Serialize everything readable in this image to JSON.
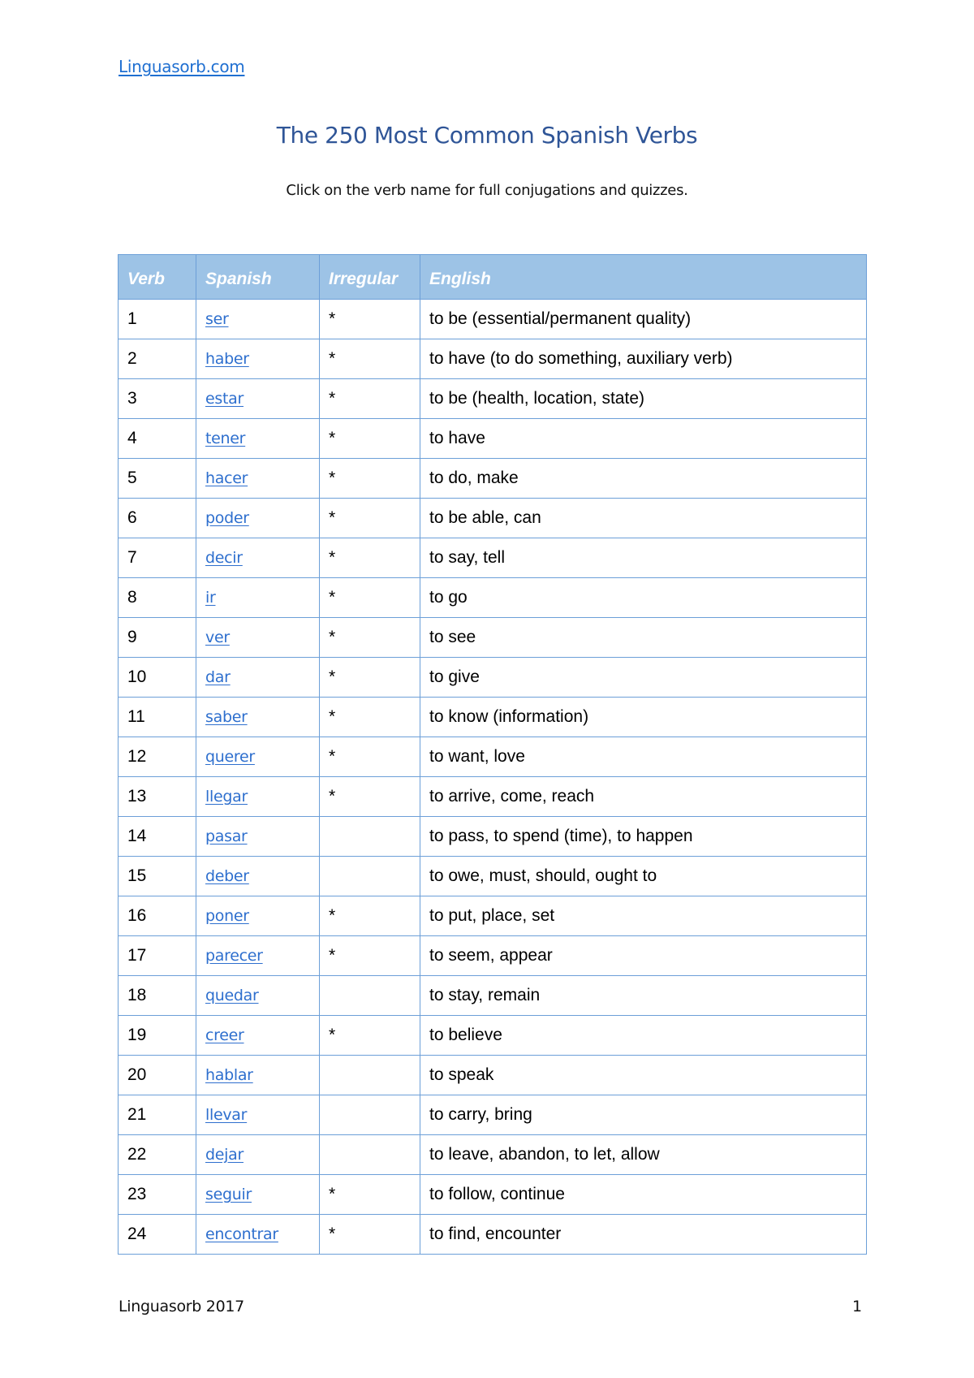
{
  "header": {
    "site_link": "Linguasorb.com"
  },
  "title": "The 250 Most Common Spanish Verbs",
  "subtitle": "Click on the verb name for full conjugations and quizzes.",
  "colors": {
    "link": "#2e6fce",
    "title": "#2f5597",
    "table_header_bg": "#9dc3e6",
    "table_border": "#6c9fd8"
  },
  "table": {
    "columns": [
      "Verb",
      "Spanish",
      "Irregular",
      "English"
    ],
    "rows": [
      {
        "num": "1",
        "spanish": "ser",
        "irregular": "*",
        "english": "to be (essential/permanent quality)"
      },
      {
        "num": "2",
        "spanish": "haber",
        "irregular": "*",
        "english": "to have (to do something, auxiliary verb)"
      },
      {
        "num": "3",
        "spanish": "estar",
        "irregular": "*",
        "english": "to be (health, location, state)"
      },
      {
        "num": "4",
        "spanish": "tener",
        "irregular": "*",
        "english": "to have"
      },
      {
        "num": "5",
        "spanish": "hacer",
        "irregular": "*",
        "english": "to do, make"
      },
      {
        "num": "6",
        "spanish": "poder",
        "irregular": "*",
        "english": "to be able, can"
      },
      {
        "num": "7",
        "spanish": "decir",
        "irregular": "*",
        "english": "to say, tell"
      },
      {
        "num": "8",
        "spanish": "ir",
        "irregular": "*",
        "english": "to go"
      },
      {
        "num": "9",
        "spanish": "ver",
        "irregular": "*",
        "english": "to see"
      },
      {
        "num": "10",
        "spanish": "dar",
        "irregular": "*",
        "english": "to give"
      },
      {
        "num": "11",
        "spanish": "saber",
        "irregular": "*",
        "english": "to know (information)"
      },
      {
        "num": "12",
        "spanish": "querer",
        "irregular": "*",
        "english": "to want, love"
      },
      {
        "num": "13",
        "spanish": "llegar",
        "irregular": "*",
        "english": "to arrive, come, reach"
      },
      {
        "num": "14",
        "spanish": "pasar",
        "irregular": "",
        "english": "to pass, to spend (time), to happen"
      },
      {
        "num": "15",
        "spanish": "deber",
        "irregular": "",
        "english": "to owe, must, should, ought to"
      },
      {
        "num": "16",
        "spanish": "poner",
        "irregular": "*",
        "english": "to put, place, set"
      },
      {
        "num": "17",
        "spanish": "parecer",
        "irregular": "*",
        "english": "to seem, appear"
      },
      {
        "num": "18",
        "spanish": "quedar",
        "irregular": "",
        "english": "to stay, remain"
      },
      {
        "num": "19",
        "spanish": "creer",
        "irregular": "*",
        "english": "to believe"
      },
      {
        "num": "20",
        "spanish": "hablar",
        "irregular": "",
        "english": "to speak"
      },
      {
        "num": "21",
        "spanish": "llevar",
        "irregular": "",
        "english": "to carry, bring"
      },
      {
        "num": "22",
        "spanish": "dejar",
        "irregular": "",
        "english": "to leave, abandon, to let, allow"
      },
      {
        "num": "23",
        "spanish": "seguir",
        "irregular": "*",
        "english": "to follow, continue"
      },
      {
        "num": "24",
        "spanish": "encontrar",
        "irregular": "*",
        "english": "to find, encounter"
      }
    ]
  },
  "footer": {
    "left": "Linguasorb 2017",
    "page_number": "1"
  }
}
